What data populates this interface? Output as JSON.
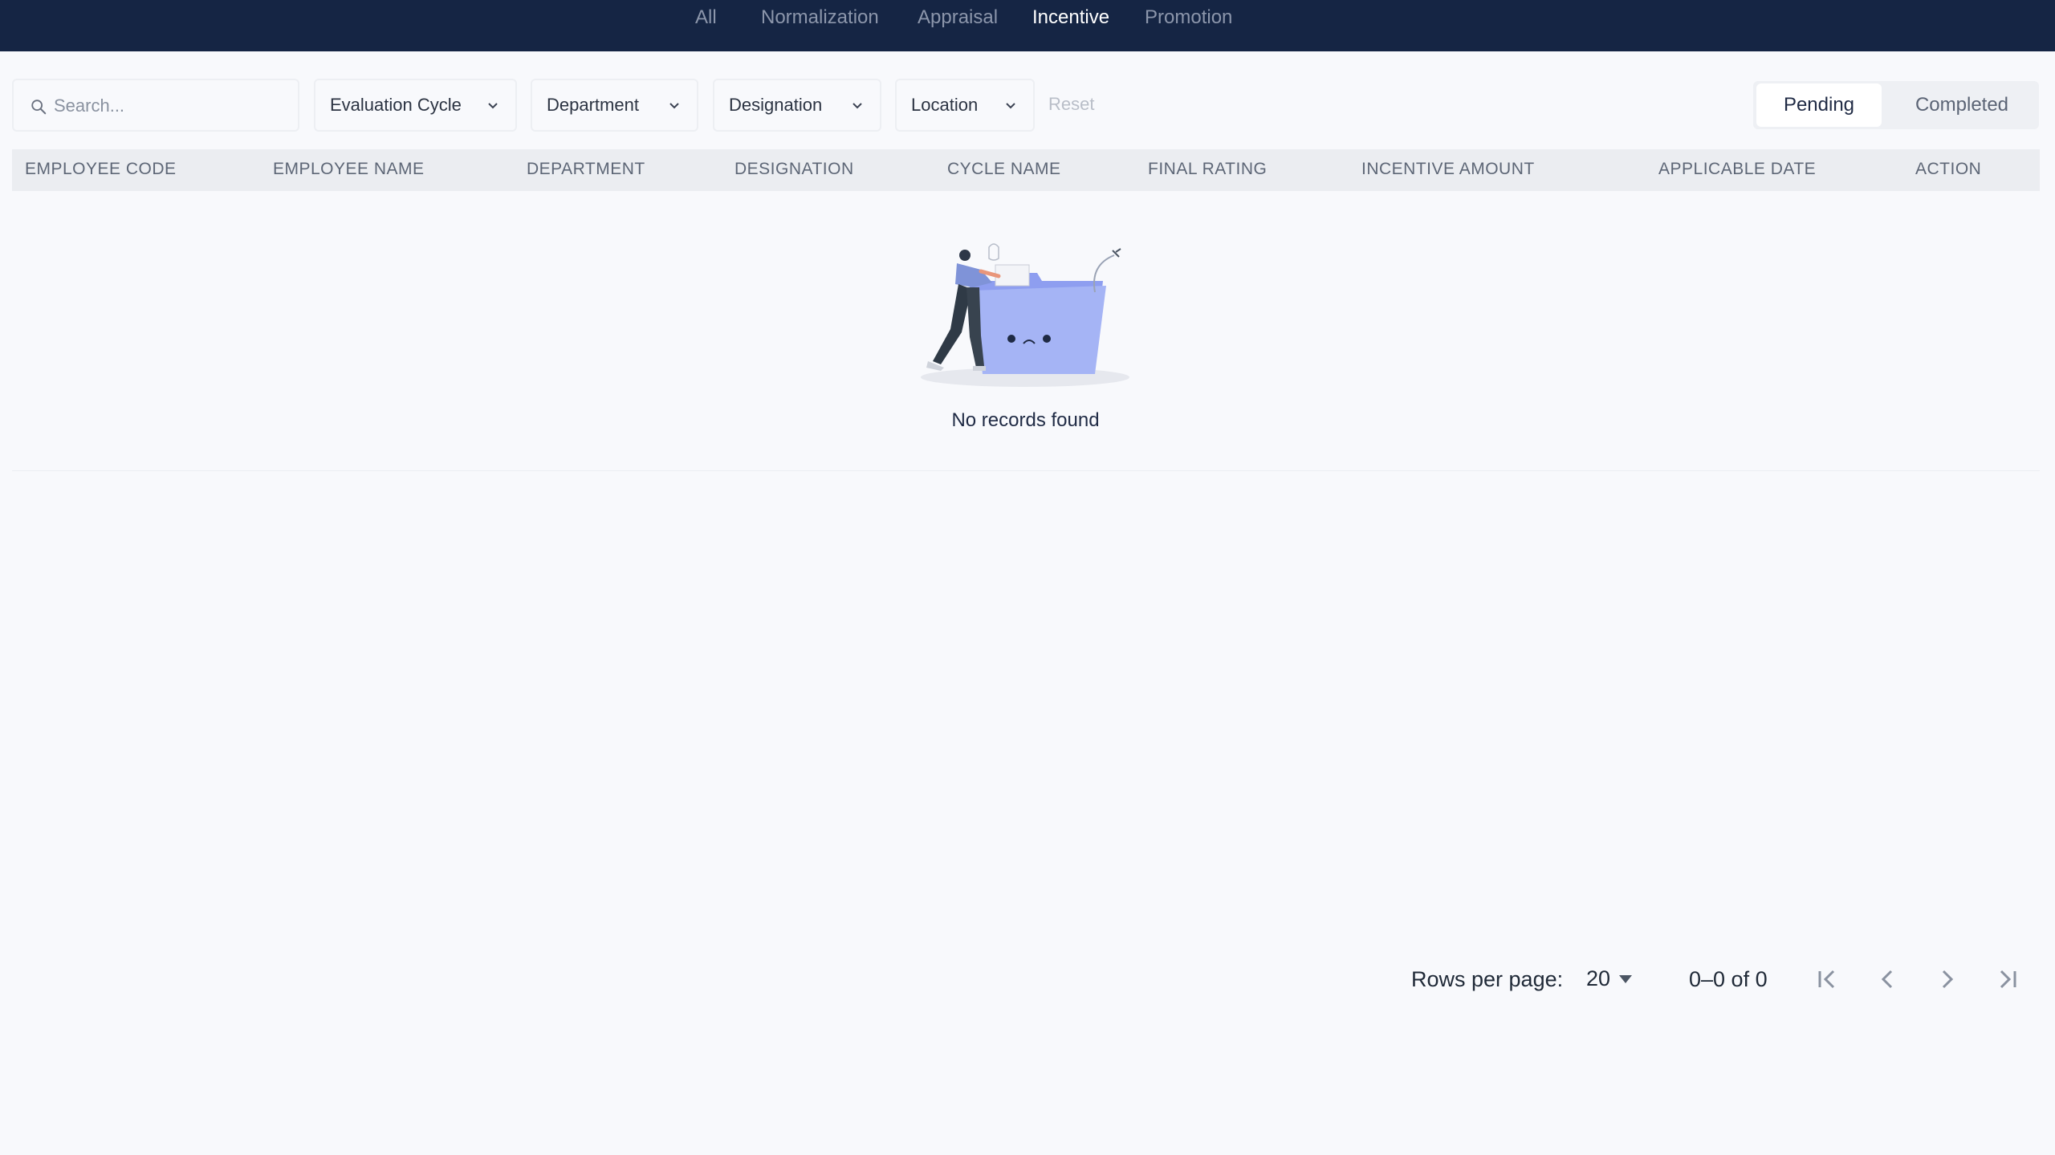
{
  "nav": {
    "tabs": [
      {
        "label": "All",
        "active": false
      },
      {
        "label": "Normalization",
        "active": false
      },
      {
        "label": "Appraisal",
        "active": false
      },
      {
        "label": "Incentive",
        "active": true
      },
      {
        "label": "Promotion",
        "active": false
      }
    ]
  },
  "filters": {
    "search_placeholder": "Search...",
    "search_value": "",
    "dropdowns": [
      "Evaluation Cycle",
      "Department",
      "Designation",
      "Location"
    ],
    "reset_label": "Reset"
  },
  "status_toggle": {
    "options": [
      "Pending",
      "Completed"
    ],
    "selected": "Pending"
  },
  "table": {
    "columns": [
      "EMPLOYEE CODE",
      "EMPLOYEE NAME",
      "DEPARTMENT",
      "DESIGNATION",
      "CYCLE NAME",
      "FINAL RATING",
      "INCENTIVE AMOUNT",
      "APPLICABLE DATE",
      "ACTION"
    ],
    "rows": [],
    "empty_message": "No records found"
  },
  "pagination": {
    "rows_per_page_label": "Rows per page:",
    "rows_per_page": "20",
    "range_text": "0–0 of 0"
  },
  "colors": {
    "navbar": "#152544",
    "active_tab": "#ffffff",
    "inactive_tab": "#8c96ab",
    "illustration_accent": "#a5b4f5"
  }
}
